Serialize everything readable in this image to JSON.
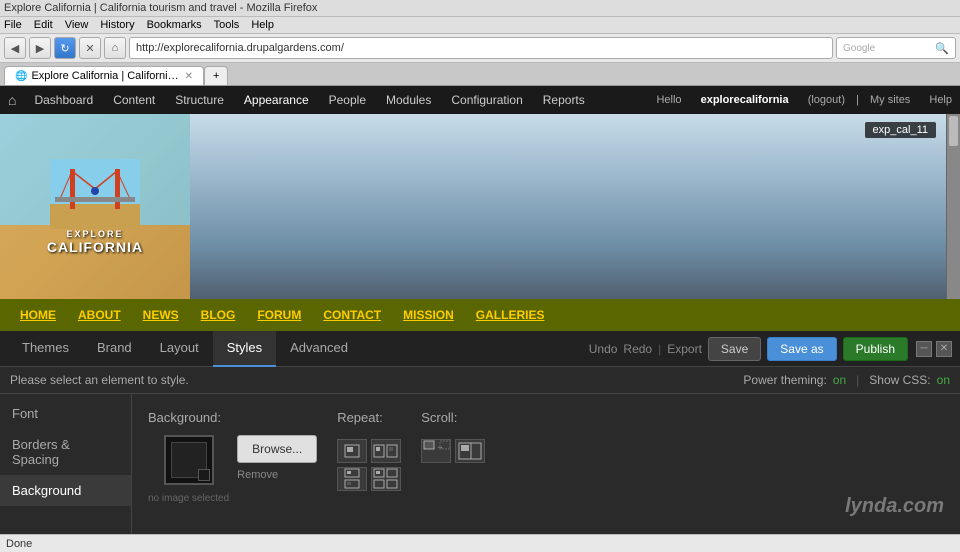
{
  "browser": {
    "title": "Explore California | California tourism and travel - Mozilla Firefox",
    "back_label": "◀",
    "forward_label": "▶",
    "reload_label": "↻",
    "stop_label": "✕",
    "home_label": "⌂",
    "address": "http://explorecalifornia.drupalgardens.com/",
    "search_placeholder": "Google",
    "tab_label": "Explore California | California tourism...",
    "tab_close": "✕",
    "menu_items": [
      "File",
      "Edit",
      "View",
      "History",
      "Bookmarks",
      "Tools",
      "Help"
    ]
  },
  "admin_bar": {
    "home_icon": "⌂",
    "nav_items": [
      "Dashboard",
      "Content",
      "Structure",
      "Appearance",
      "People",
      "Modules",
      "Configuration",
      "Reports"
    ],
    "hello_text": "Hello",
    "username": "explorecalifornia",
    "logout_label": "(logout)",
    "my_sites_label": "My sites",
    "help_label": "Help"
  },
  "site": {
    "logo_explore": "EXPLORE",
    "logo_california": "CALIFORNIA",
    "nav_items": [
      "HOME",
      "ABOUT",
      "NEWS",
      "BLOG",
      "FORUM",
      "CONTACT",
      "MISSION",
      "GALLERIES"
    ]
  },
  "tooltip": {
    "text": "exp_cal_11"
  },
  "themer": {
    "tabs": [
      "Themes",
      "Brand",
      "Layout",
      "Styles",
      "Advanced"
    ],
    "active_tab": "Styles",
    "undo_label": "Undo",
    "redo_label": "Redo",
    "export_label": "Export",
    "save_label": "Save",
    "save_as_label": "Save as",
    "publish_label": "Publish",
    "minimize_label": "─",
    "close_label": "✕",
    "status_text": "Please select an element to style.",
    "power_theming_label": "Power theming:",
    "power_theming_value": "on",
    "show_css_label": "Show CSS:",
    "show_css_value": "on",
    "sidebar_items": [
      "Font",
      "Borders & Spacing",
      "Background"
    ],
    "active_sidebar": "Background",
    "background_section": {
      "title": "Background:",
      "no_image_text": "no image selected",
      "browse_label": "Browse...",
      "remove_label": "Remove"
    },
    "repeat_section": {
      "title": "Repeat:"
    },
    "scroll_section": {
      "title": "Scroll:"
    }
  },
  "status_bar": {
    "text": "Done"
  },
  "watermark": "lynda.com"
}
